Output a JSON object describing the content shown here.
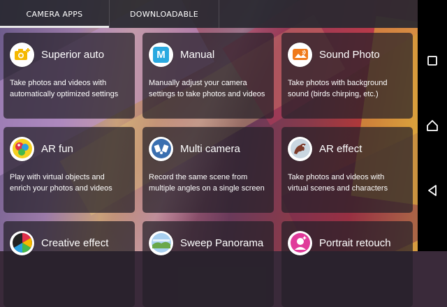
{
  "tabs": [
    {
      "label": "CAMERA APPS",
      "active": true
    },
    {
      "label": "DOWNLOADABLE",
      "active": false
    }
  ],
  "apps": [
    {
      "title": "Superior auto",
      "desc": "Take photos and videos with automatically optimized settings",
      "icon": "camera-plus-icon",
      "color": "#f5b800"
    },
    {
      "title": "Manual",
      "desc": "Manually adjust your camera settings to take photos and videos",
      "icon": "manual-m-icon",
      "color": "#2aa9e0"
    },
    {
      "title": "Sound Photo",
      "desc": "Take photos with background sound (birds chirping, etc.)",
      "icon": "sound-photo-icon",
      "color": "#f07a1a"
    },
    {
      "title": "AR fun",
      "desc": "Play with virtual objects and enrich your photos and videos",
      "icon": "ar-fun-icon",
      "color": "#e0304a"
    },
    {
      "title": "Multi camera",
      "desc": "Record the same scene from multiple angles on a single screen",
      "icon": "multi-camera-icon",
      "color": "#3a6fb0"
    },
    {
      "title": "AR effect",
      "desc": "Take photos and videos with virtual scenes and characters",
      "icon": "ar-effect-icon",
      "color": "#7a3a2a"
    },
    {
      "title": "Creative effect",
      "desc": "",
      "icon": "creative-effect-icon",
      "color": "#d04a2a"
    },
    {
      "title": "Sweep Panorama",
      "desc": "",
      "icon": "sweep-panorama-icon",
      "color": "#6aa84a"
    },
    {
      "title": "Portrait retouch",
      "desc": "",
      "icon": "portrait-retouch-icon",
      "color": "#e03a9a"
    }
  ],
  "nav": {
    "recents": "recents-icon",
    "home": "home-icon",
    "back": "back-icon"
  }
}
